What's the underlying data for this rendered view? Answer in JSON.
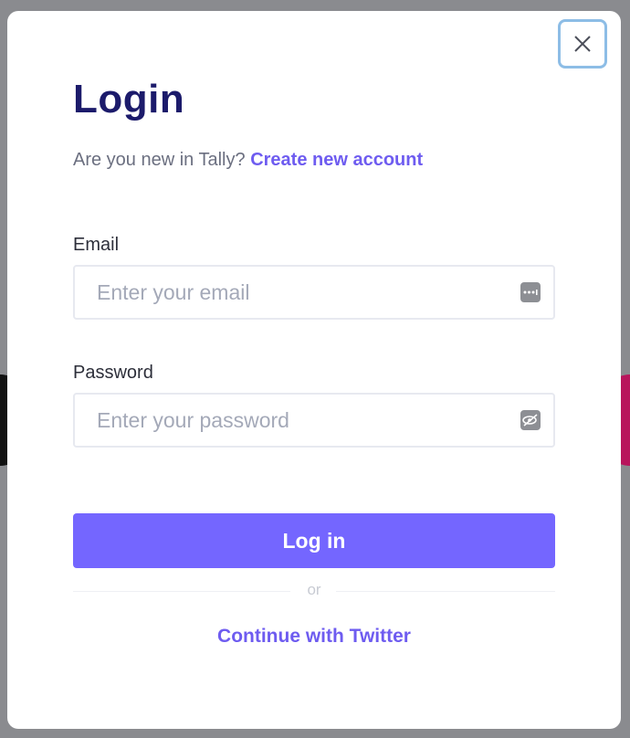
{
  "modal": {
    "title": "Login",
    "subtitle_prefix": "Are you new in Tally?",
    "create_account_link": "Create new account",
    "email": {
      "label": "Email",
      "placeholder": "Enter your email",
      "value": ""
    },
    "password": {
      "label": "Password",
      "placeholder": "Enter your password",
      "value": ""
    },
    "login_button": "Log in",
    "divider_text": "or",
    "twitter_link": "Continue with Twitter"
  },
  "colors": {
    "title": "#1c1b6b",
    "accent": "#7466ff",
    "link": "#6e5cf0",
    "close_focus_ring": "#8dbde6"
  },
  "icons": {
    "close": "close-icon",
    "email_field": "password-manager-icon",
    "password_field": "password-manager-eye-icon"
  }
}
